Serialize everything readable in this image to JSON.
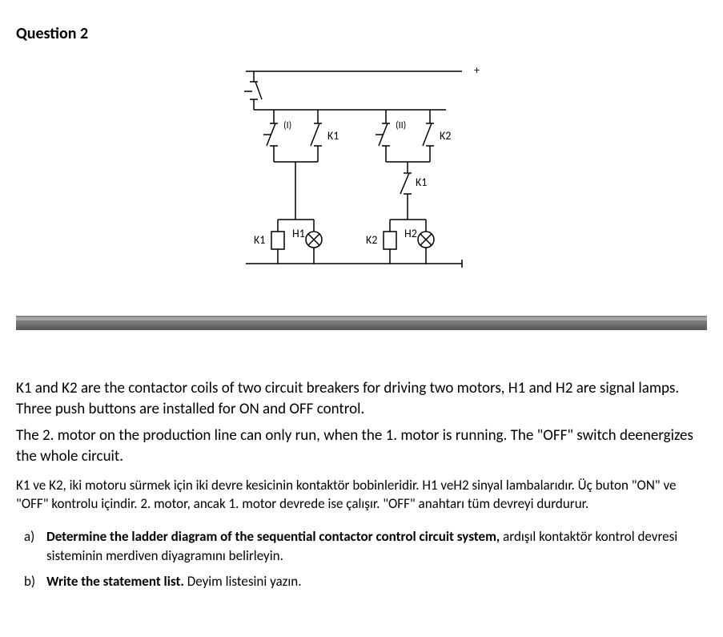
{
  "title": "Question 2",
  "diagram": {
    "labels": {
      "plus": "+",
      "one": "(I)",
      "two": "(II)",
      "K1_right": "K1",
      "K2_right": "K2",
      "K1_lower": "K1",
      "K1_coil": "K1",
      "H1_lamp": "H1",
      "K2_coil": "K2",
      "H2_lamp": "H2"
    }
  },
  "para1": "K1 and K2 are the contactor coils of two circuit breakers for driving two motors, H1 and H2 are signal lamps. Three push buttons are installed for ON and OFF control.",
  "para2": "The 2. motor on the production line can only run, when the 1. motor is running. The \"OFF\" switch deenergizes the whole circuit.",
  "para3": "K1 ve K2, iki motoru sürmek için iki devre kesicinin kontaktör bobinleridir. H1 veH2 sinyal lambalarıdır. Üç buton \"ON\" ve \"OFF\" kontrolu içindir. 2. motor, ancak 1. motor devrede ise çalışır. \"OFF\" anahtarı tüm devreyi durdurur.",
  "items": {
    "a": {
      "marker": "a)",
      "bold": "Determine the ladder diagram of the sequential contactor control circuit system,",
      "rest": " ardışıl kontaktör kontrol devresi sisteminin merdiven diyagramını belirleyin."
    },
    "b": {
      "marker": "b)",
      "bold": "Write the statement list.",
      "rest": " Deyim listesini yazın."
    }
  }
}
